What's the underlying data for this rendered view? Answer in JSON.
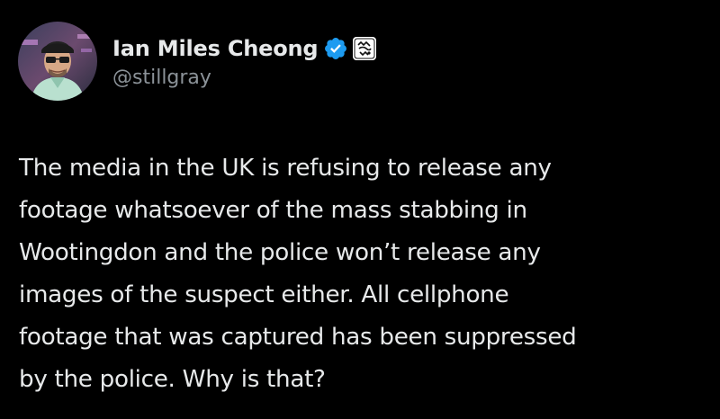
{
  "author": {
    "display_name": "Ian Miles Cheong",
    "handle": "@stillgray",
    "verified_icon": "verified-badge-icon",
    "affiliate_icon": "affiliate-badge-icon",
    "colors": {
      "verified": "#1d9bf0",
      "name": "#e7e9ea",
      "handle": "#8b9298"
    }
  },
  "tweet": {
    "lines": [
      "The media in the UK is refusing to release any",
      "footage whatsoever of the mass stabbing in",
      "Wootingdon and the police won’t release any",
      "images of the suspect either. All cellphone",
      "footage that was captured has been suppressed",
      "by the police. Why is that?"
    ]
  },
  "theme": {
    "background": "#000000",
    "text": "#e7e9ea"
  }
}
